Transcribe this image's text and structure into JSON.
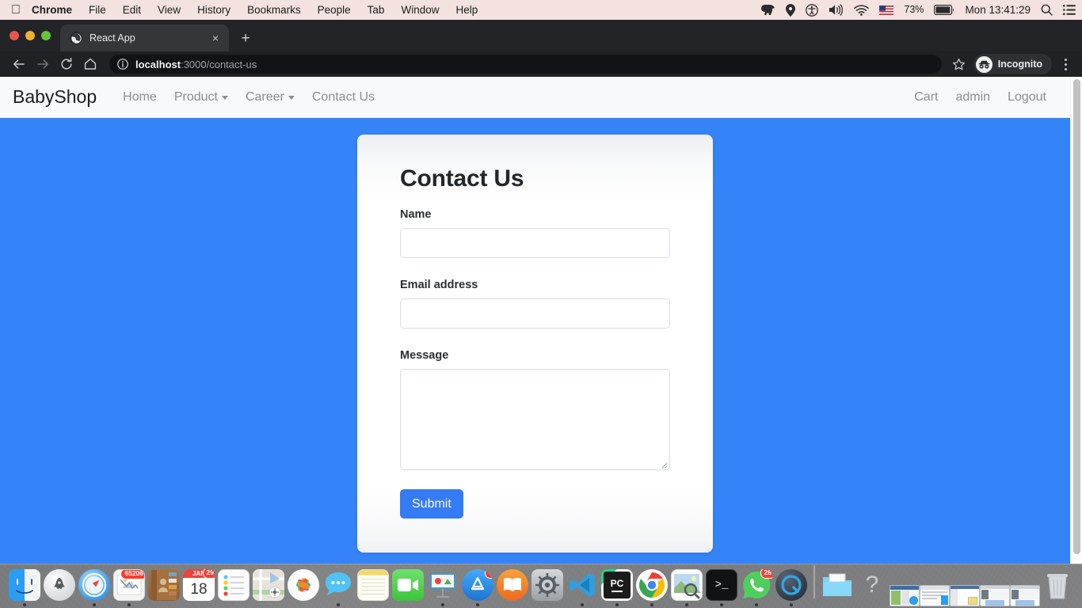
{
  "menubar": {
    "apple_icon": "apple-logo-icon",
    "items": [
      {
        "label": "Chrome",
        "bold": true
      },
      {
        "label": "File",
        "bold": false
      },
      {
        "label": "Edit",
        "bold": false
      },
      {
        "label": "View",
        "bold": false
      },
      {
        "label": "History",
        "bold": false
      },
      {
        "label": "Bookmarks",
        "bold": false
      },
      {
        "label": "People",
        "bold": false
      },
      {
        "label": "Tab",
        "bold": false
      },
      {
        "label": "Window",
        "bold": false
      },
      {
        "label": "Help",
        "bold": false
      }
    ],
    "status": {
      "dropbox_icon": "dropbox-elephant-icon",
      "location_icon": "location-pin-icon",
      "accessibility_icon": "accessibility-icon",
      "volume_icon": "volume-speaker-icon",
      "wifi_icon": "wifi-icon",
      "input_flag_icon": "us-flag-icon",
      "battery_percent": "73%",
      "battery_icon": "battery-icon",
      "clock": "Mon 13:41:29",
      "search_icon": "spotlight-search-icon",
      "notification_icon": "notification-center-icon"
    }
  },
  "browser": {
    "window_controls": {
      "close": "close-window-button",
      "minimize": "minimize-window-button",
      "zoom": "zoom-window-button"
    },
    "tab": {
      "title": "React App",
      "favicon": "react-app-favicon",
      "close_label": "×"
    },
    "new_tab_label": "+",
    "toolbar": {
      "back_icon": "back-arrow-icon",
      "forward_icon": "forward-arrow-icon",
      "reload_icon": "reload-icon",
      "home_icon": "home-icon",
      "site_info_icon": "site-info-icon",
      "url_host": "localhost",
      "url_rest": ":3000/contact-us",
      "bookmark_icon": "bookmark-star-icon",
      "incognito_label": "Incognito",
      "incognito_icon": "incognito-spy-icon",
      "menu_icon": "three-dot-menu-icon"
    }
  },
  "site": {
    "brand": "BabyShop",
    "nav_left": [
      {
        "label": "Home",
        "caret": false
      },
      {
        "label": "Product",
        "caret": true
      },
      {
        "label": "Career",
        "caret": true
      },
      {
        "label": "Contact Us",
        "caret": false
      }
    ],
    "nav_right": [
      {
        "label": "Cart"
      },
      {
        "label": "admin"
      },
      {
        "label": "Logout"
      }
    ],
    "background_color": "#3484f7"
  },
  "form": {
    "title": "Contact Us",
    "fields": [
      {
        "label": "Name",
        "value": "",
        "placeholder": "",
        "type": "text",
        "name": "name-input"
      },
      {
        "label": "Email address",
        "value": "",
        "placeholder": "",
        "type": "email",
        "name": "email-input"
      },
      {
        "label": "Message",
        "value": "",
        "placeholder": "",
        "type": "textarea",
        "name": "message-textarea"
      }
    ],
    "submit_label": "Submit",
    "submit_color": "#347bf4"
  },
  "dock": {
    "items": [
      {
        "name": "finder",
        "icon": "finder-icon",
        "running": true,
        "badge": ""
      },
      {
        "name": "launchpad",
        "icon": "launchpad-icon",
        "running": false,
        "badge": ""
      },
      {
        "name": "safari",
        "icon": "safari-icon",
        "running": true,
        "badge": ""
      },
      {
        "name": "mail",
        "icon": "mail-icon",
        "running": true,
        "badge": "65206"
      },
      {
        "name": "contacts",
        "icon": "contacts-icon",
        "running": false,
        "badge": ""
      },
      {
        "name": "calendar",
        "icon": "calendar-icon",
        "running": false,
        "badge": "29",
        "day": "18",
        "month": "JAN"
      },
      {
        "name": "reminders",
        "icon": "reminders-icon",
        "running": false,
        "badge": ""
      },
      {
        "name": "maps",
        "icon": "maps-icon",
        "running": false,
        "badge": ""
      },
      {
        "name": "photos",
        "icon": "photos-icon",
        "running": false,
        "badge": ""
      },
      {
        "name": "messages",
        "icon": "messages-icon",
        "running": true,
        "badge": ""
      },
      {
        "name": "notes",
        "icon": "notes-icon",
        "running": false,
        "badge": ""
      },
      {
        "name": "facetime",
        "icon": "facetime-icon",
        "running": false,
        "badge": ""
      },
      {
        "name": "keynote",
        "icon": "keynote-icon",
        "running": true,
        "badge": ""
      },
      {
        "name": "app-store",
        "icon": "app-store-icon",
        "running": true,
        "badge": "4"
      },
      {
        "name": "ibooks",
        "icon": "ibooks-icon",
        "running": false,
        "badge": ""
      },
      {
        "name": "system-preferences",
        "icon": "system-preferences-icon",
        "running": false,
        "badge": ""
      },
      {
        "name": "vs-code",
        "icon": "vs-code-icon",
        "running": true,
        "badge": ""
      },
      {
        "name": "pycharm",
        "icon": "pycharm-icon",
        "running": true,
        "badge": "",
        "text": "PC"
      },
      {
        "name": "chrome",
        "icon": "chrome-icon",
        "running": true,
        "badge": ""
      },
      {
        "name": "preview",
        "icon": "preview-icon",
        "running": true,
        "badge": ""
      },
      {
        "name": "terminal",
        "icon": "terminal-icon",
        "running": true,
        "badge": "",
        "text": ">_"
      },
      {
        "name": "whatsapp",
        "icon": "whatsapp-icon",
        "running": true,
        "badge": "26"
      },
      {
        "name": "quicktime",
        "icon": "quicktime-icon",
        "running": true,
        "badge": ""
      }
    ],
    "right_items": [
      {
        "name": "downloads-folder",
        "icon": "downloads-folder-icon"
      },
      {
        "name": "help-question",
        "icon": "question-mark-icon",
        "text": "?"
      }
    ],
    "minimized_windows": [
      {
        "name": "minimized-window-1"
      },
      {
        "name": "minimized-window-2"
      },
      {
        "name": "minimized-window-3"
      },
      {
        "name": "minimized-window-4"
      },
      {
        "name": "minimized-window-5"
      }
    ],
    "trash": {
      "name": "trash",
      "icon": "trash-icon"
    }
  }
}
